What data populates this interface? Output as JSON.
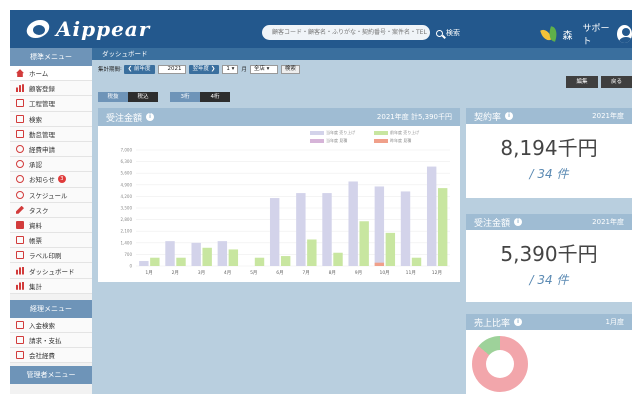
{
  "header": {
    "logo_text": "Aippear",
    "search_placeholder": "顧客コード・顧客名・ふりがな・契約番号・案件名・TEL",
    "search_button": "検索",
    "user_name": "森",
    "support_label": "サポート"
  },
  "sidebar": {
    "section1": "標準メニュー",
    "items": [
      {
        "label": "ホーム",
        "icon": "home-icon"
      },
      {
        "label": "顧客登録",
        "icon": "building-icon"
      },
      {
        "label": "工程管理",
        "icon": "flag-icon"
      },
      {
        "label": "検索",
        "icon": "search-doc-icon"
      },
      {
        "label": "勤怠管理",
        "icon": "clock-icon"
      },
      {
        "label": "経費申請",
        "icon": "yen-icon"
      },
      {
        "label": "承認",
        "icon": "approve-icon"
      },
      {
        "label": "お知らせ",
        "icon": "notice-icon",
        "badge": "3"
      },
      {
        "label": "スケジュール",
        "icon": "calendar-icon"
      },
      {
        "label": "タスク",
        "icon": "task-icon"
      },
      {
        "label": "資料",
        "icon": "folder-icon"
      },
      {
        "label": "帳票",
        "icon": "report-icon"
      },
      {
        "label": "ラベル印刷",
        "icon": "label-icon"
      },
      {
        "label": "ダッシュボード",
        "icon": "dashboard-icon"
      },
      {
        "label": "集計",
        "icon": "aggregate-icon"
      }
    ],
    "section2": "経理メニュー",
    "items2": [
      {
        "label": "入金検索",
        "icon": "deposit-icon"
      },
      {
        "label": "請求・支払",
        "icon": "invoice-icon"
      },
      {
        "label": "会社経費",
        "icon": "expense-icon"
      }
    ],
    "section3": "管理者メニュー"
  },
  "content": {
    "title": "ダッシュボード",
    "filter": {
      "label": "集計期間",
      "prev_year": "前年度",
      "year": "2021",
      "next_year": "翌年度",
      "month": "1",
      "month_suffix": "月",
      "store": "全店",
      "search": "検索"
    },
    "edit_button": "編集",
    "back_button": "戻る",
    "toggles": [
      "税抜",
      "税込",
      "3桁",
      "4桁"
    ]
  },
  "chart_panel": {
    "title": "受注金額",
    "summary": "2021年度 計5,390千円"
  },
  "chart_data": {
    "type": "bar",
    "categories": [
      "1月",
      "2月",
      "3月",
      "4月",
      "5月",
      "6月",
      "7月",
      "8月",
      "9月",
      "10月",
      "11月",
      "12月"
    ],
    "yticks": [
      "0",
      "700",
      "1,400",
      "2,100",
      "2,800",
      "3,500",
      "4,200",
      "4,900",
      "5,600",
      "6,300",
      "7,000"
    ],
    "ylim": [
      0,
      7000
    ],
    "series": [
      {
        "name": "当年度 売り上げ",
        "color": "#d3d3ea",
        "values": [
          300,
          1500,
          1400,
          1500,
          0,
          4100,
          4400,
          4400,
          5100,
          4800,
          4500,
          6000
        ]
      },
      {
        "name": "前年度 売り上げ",
        "color": "#c8e6a0",
        "values": [
          500,
          500,
          1100,
          1000,
          500,
          600,
          1600,
          800,
          2700,
          2000,
          500,
          4700
        ]
      },
      {
        "name": "当年度 見積",
        "color": "#d6b4d8",
        "values": [
          0,
          0,
          0,
          0,
          0,
          0,
          0,
          0,
          0,
          0,
          0,
          0
        ]
      },
      {
        "name": "昨年度 見積",
        "color": "#f0a08a",
        "values": [
          0,
          0,
          0,
          0,
          0,
          0,
          0,
          0,
          0,
          200,
          0,
          0
        ]
      }
    ],
    "legend_position": "top-right"
  },
  "cards": {
    "contract_rate": {
      "title": "契約率",
      "period": "2021年度",
      "value": "8,194千円",
      "count": "/ 34 件"
    },
    "orders": {
      "title": "受注金額",
      "period": "2021年度",
      "value": "5,390千円",
      "count": "/ 34 件"
    },
    "sales_ratio": {
      "title": "売上比率",
      "period": "1月度",
      "ratio": [
        0.86,
        0.14
      ]
    }
  },
  "colors": {
    "header": "#23588d",
    "panel_head": "#9fbcd3",
    "background": "#b9cfdf",
    "accent_red": "#d23b3b"
  }
}
